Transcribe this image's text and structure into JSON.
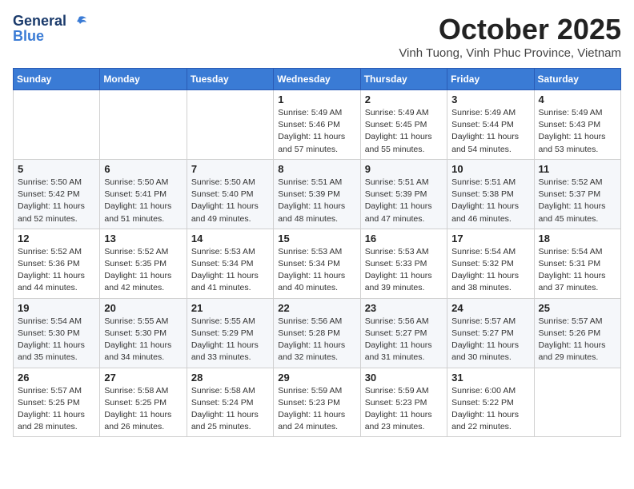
{
  "header": {
    "logo_line1": "General",
    "logo_line2": "Blue",
    "month": "October 2025",
    "location": "Vinh Tuong, Vinh Phuc Province, Vietnam"
  },
  "weekdays": [
    "Sunday",
    "Monday",
    "Tuesday",
    "Wednesday",
    "Thursday",
    "Friday",
    "Saturday"
  ],
  "weeks": [
    [
      {
        "day": "",
        "info": ""
      },
      {
        "day": "",
        "info": ""
      },
      {
        "day": "",
        "info": ""
      },
      {
        "day": "1",
        "info": "Sunrise: 5:49 AM\nSunset: 5:46 PM\nDaylight: 11 hours\nand 57 minutes."
      },
      {
        "day": "2",
        "info": "Sunrise: 5:49 AM\nSunset: 5:45 PM\nDaylight: 11 hours\nand 55 minutes."
      },
      {
        "day": "3",
        "info": "Sunrise: 5:49 AM\nSunset: 5:44 PM\nDaylight: 11 hours\nand 54 minutes."
      },
      {
        "day": "4",
        "info": "Sunrise: 5:49 AM\nSunset: 5:43 PM\nDaylight: 11 hours\nand 53 minutes."
      }
    ],
    [
      {
        "day": "5",
        "info": "Sunrise: 5:50 AM\nSunset: 5:42 PM\nDaylight: 11 hours\nand 52 minutes."
      },
      {
        "day": "6",
        "info": "Sunrise: 5:50 AM\nSunset: 5:41 PM\nDaylight: 11 hours\nand 51 minutes."
      },
      {
        "day": "7",
        "info": "Sunrise: 5:50 AM\nSunset: 5:40 PM\nDaylight: 11 hours\nand 49 minutes."
      },
      {
        "day": "8",
        "info": "Sunrise: 5:51 AM\nSunset: 5:39 PM\nDaylight: 11 hours\nand 48 minutes."
      },
      {
        "day": "9",
        "info": "Sunrise: 5:51 AM\nSunset: 5:39 PM\nDaylight: 11 hours\nand 47 minutes."
      },
      {
        "day": "10",
        "info": "Sunrise: 5:51 AM\nSunset: 5:38 PM\nDaylight: 11 hours\nand 46 minutes."
      },
      {
        "day": "11",
        "info": "Sunrise: 5:52 AM\nSunset: 5:37 PM\nDaylight: 11 hours\nand 45 minutes."
      }
    ],
    [
      {
        "day": "12",
        "info": "Sunrise: 5:52 AM\nSunset: 5:36 PM\nDaylight: 11 hours\nand 44 minutes."
      },
      {
        "day": "13",
        "info": "Sunrise: 5:52 AM\nSunset: 5:35 PM\nDaylight: 11 hours\nand 42 minutes."
      },
      {
        "day": "14",
        "info": "Sunrise: 5:53 AM\nSunset: 5:34 PM\nDaylight: 11 hours\nand 41 minutes."
      },
      {
        "day": "15",
        "info": "Sunrise: 5:53 AM\nSunset: 5:34 PM\nDaylight: 11 hours\nand 40 minutes."
      },
      {
        "day": "16",
        "info": "Sunrise: 5:53 AM\nSunset: 5:33 PM\nDaylight: 11 hours\nand 39 minutes."
      },
      {
        "day": "17",
        "info": "Sunrise: 5:54 AM\nSunset: 5:32 PM\nDaylight: 11 hours\nand 38 minutes."
      },
      {
        "day": "18",
        "info": "Sunrise: 5:54 AM\nSunset: 5:31 PM\nDaylight: 11 hours\nand 37 minutes."
      }
    ],
    [
      {
        "day": "19",
        "info": "Sunrise: 5:54 AM\nSunset: 5:30 PM\nDaylight: 11 hours\nand 35 minutes."
      },
      {
        "day": "20",
        "info": "Sunrise: 5:55 AM\nSunset: 5:30 PM\nDaylight: 11 hours\nand 34 minutes."
      },
      {
        "day": "21",
        "info": "Sunrise: 5:55 AM\nSunset: 5:29 PM\nDaylight: 11 hours\nand 33 minutes."
      },
      {
        "day": "22",
        "info": "Sunrise: 5:56 AM\nSunset: 5:28 PM\nDaylight: 11 hours\nand 32 minutes."
      },
      {
        "day": "23",
        "info": "Sunrise: 5:56 AM\nSunset: 5:27 PM\nDaylight: 11 hours\nand 31 minutes."
      },
      {
        "day": "24",
        "info": "Sunrise: 5:57 AM\nSunset: 5:27 PM\nDaylight: 11 hours\nand 30 minutes."
      },
      {
        "day": "25",
        "info": "Sunrise: 5:57 AM\nSunset: 5:26 PM\nDaylight: 11 hours\nand 29 minutes."
      }
    ],
    [
      {
        "day": "26",
        "info": "Sunrise: 5:57 AM\nSunset: 5:25 PM\nDaylight: 11 hours\nand 28 minutes."
      },
      {
        "day": "27",
        "info": "Sunrise: 5:58 AM\nSunset: 5:25 PM\nDaylight: 11 hours\nand 26 minutes."
      },
      {
        "day": "28",
        "info": "Sunrise: 5:58 AM\nSunset: 5:24 PM\nDaylight: 11 hours\nand 25 minutes."
      },
      {
        "day": "29",
        "info": "Sunrise: 5:59 AM\nSunset: 5:23 PM\nDaylight: 11 hours\nand 24 minutes."
      },
      {
        "day": "30",
        "info": "Sunrise: 5:59 AM\nSunset: 5:23 PM\nDaylight: 11 hours\nand 23 minutes."
      },
      {
        "day": "31",
        "info": "Sunrise: 6:00 AM\nSunset: 5:22 PM\nDaylight: 11 hours\nand 22 minutes."
      },
      {
        "day": "",
        "info": ""
      }
    ]
  ]
}
